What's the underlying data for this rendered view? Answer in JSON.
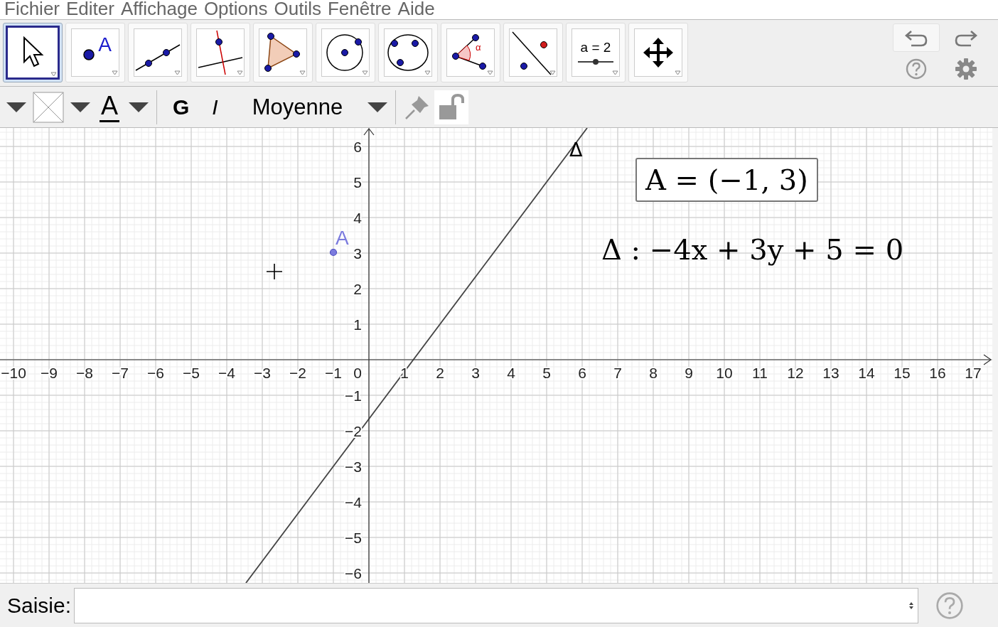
{
  "menu": [
    "Fichier",
    "Editer",
    "Affichage",
    "Options",
    "Outils",
    "Fenêtre",
    "Aide"
  ],
  "tools": [
    {
      "kind": "move",
      "selected": true
    },
    {
      "kind": "point",
      "label": "A",
      "selected": false
    },
    {
      "kind": "line",
      "selected": false
    },
    {
      "kind": "perpendicular",
      "selected": false
    },
    {
      "kind": "polygon",
      "selected": false
    },
    {
      "kind": "circle",
      "selected": false
    },
    {
      "kind": "conic",
      "selected": false
    },
    {
      "kind": "angle",
      "label": "α",
      "selected": false
    },
    {
      "kind": "reflect",
      "selected": false
    },
    {
      "kind": "slider",
      "label": "a = 2",
      "selected": false
    },
    {
      "kind": "pan",
      "selected": false
    }
  ],
  "style_bar": {
    "text_color_label": "A",
    "bold": "G",
    "italic": "I",
    "font_size": "Moyenne"
  },
  "graph": {
    "x_labels": [
      "−10",
      "−9",
      "−8",
      "−7",
      "−6",
      "−5",
      "−4",
      "−3",
      "−2",
      "−1",
      "1",
      "2",
      "3",
      "4",
      "5",
      "6",
      "7",
      "8",
      "9",
      "10",
      "11",
      "12",
      "13",
      "14",
      "15",
      "16",
      "17"
    ],
    "y_labels": [
      "6",
      "5",
      "4",
      "3",
      "2",
      "1",
      "−1",
      "−2",
      "−3",
      "−4",
      "−5",
      "−6"
    ],
    "origin": "0",
    "point_label": "A",
    "line_label": "Δ"
  },
  "algebra": {
    "point": "A = (−1, 3)",
    "line": "Δ : −4x + 3y + 5 = 0"
  },
  "input_bar": {
    "label": "Saisie:"
  }
}
